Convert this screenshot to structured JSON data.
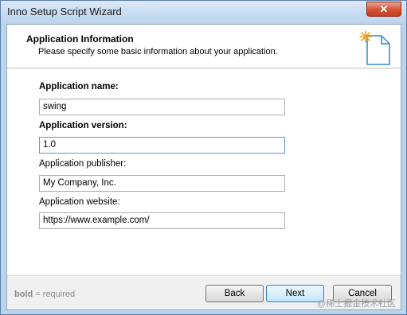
{
  "window": {
    "title": "Inno Setup Script Wizard",
    "close_glyph": "✕"
  },
  "header": {
    "title": "Application Information",
    "subtitle": "Please specify some basic information about your application.",
    "icon": "document-star-icon"
  },
  "fields": [
    {
      "label": "Application name:",
      "required": true,
      "value": "swing"
    },
    {
      "label": "Application version:",
      "required": true,
      "value": "1.0"
    },
    {
      "label": "Application publisher:",
      "required": false,
      "value": "My Company, Inc."
    },
    {
      "label": "Application website:",
      "required": false,
      "value": "https://www.example.com/"
    }
  ],
  "footer": {
    "legend_bold": "bold",
    "legend_rest": " = required",
    "back_label": "Back",
    "next_label": "Next",
    "cancel_label": "Cancel"
  },
  "watermark": "@稀土掘金技术社区",
  "colors": {
    "accent": "#3c7fb1",
    "icon_star": "#f5a01a",
    "icon_outline": "#2e8bc9"
  }
}
